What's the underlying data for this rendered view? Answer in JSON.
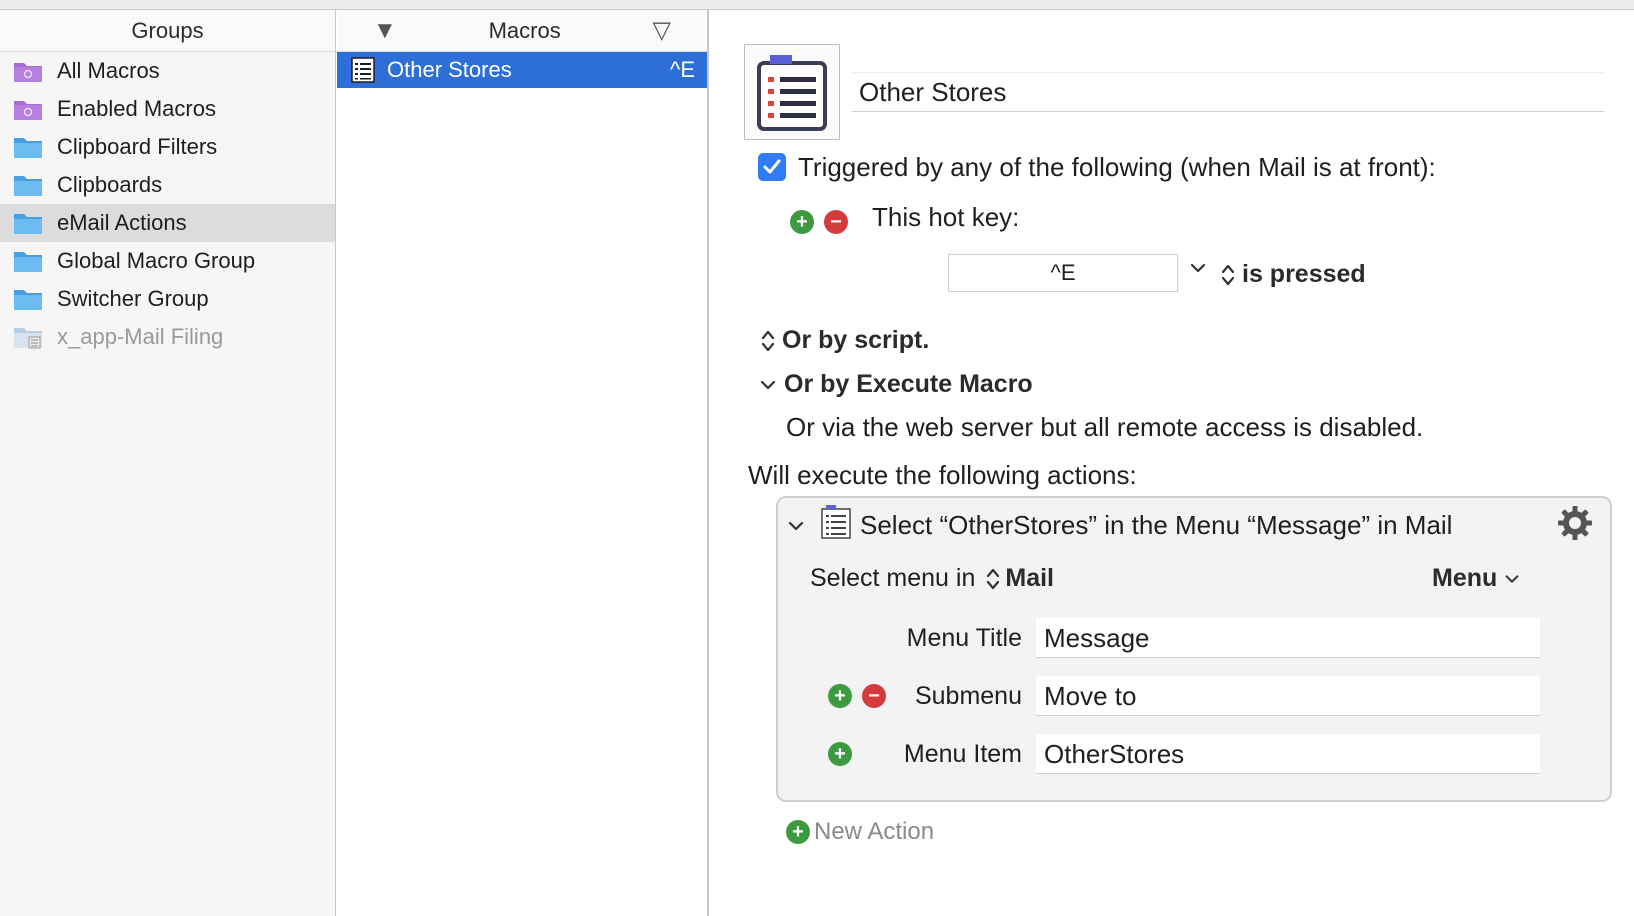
{
  "groups": {
    "header": "Groups",
    "items": [
      {
        "label": "All Macros",
        "icon": "smart-group-icon",
        "color": "#a86ad8"
      },
      {
        "label": "Enabled Macros",
        "icon": "smart-group-icon",
        "color": "#a86ad8"
      },
      {
        "label": "Clipboard Filters",
        "icon": "folder-icon",
        "color": "#5aaee9"
      },
      {
        "label": "Clipboards",
        "icon": "folder-icon",
        "color": "#5aaee9"
      },
      {
        "label": "eMail Actions",
        "icon": "folder-icon",
        "color": "#5aaee9"
      },
      {
        "label": "Global Macro Group",
        "icon": "folder-icon",
        "color": "#5aaee9"
      },
      {
        "label": "Switcher Group",
        "icon": "folder-icon",
        "color": "#5aaee9"
      },
      {
        "label": "x_app-Mail Filing",
        "icon": "disabled-folder-icon",
        "color": "#c9d9e8"
      }
    ],
    "selected": "eMail Actions"
  },
  "macros": {
    "header": "Macros",
    "items": [
      {
        "label": "Other Stores",
        "hotkey": "^E"
      }
    ]
  },
  "editor": {
    "macro_name": "Other Stores",
    "trigger_text": "Triggered by any of the following (when Mail is at front):",
    "hotkey_label": "This hot key:",
    "hotkey_value": "^E",
    "hotkey_state": "is pressed",
    "or_by_script": "Or by script.",
    "or_by_execute": "Or by Execute Macro",
    "web_server_text": "Or via the web server but all remote access is disabled.",
    "will_execute": "Will execute the following actions:",
    "action": {
      "title": "Select “OtherStores” in the Menu “Message” in Mail",
      "select_menu_in": "Select menu in",
      "app": "Mail",
      "menu_dropdown": "Menu",
      "menu_title_label": "Menu Title",
      "menu_title_value": "Message",
      "submenu_label": "Submenu",
      "submenu_value": "Move to",
      "menu_item_label": "Menu Item",
      "menu_item_value": "OtherStores"
    },
    "new_action": "New Action"
  },
  "colors": {
    "selection_blue": "#2e6fd7",
    "checkbox_blue": "#2f7cf6",
    "plus_green": "#3d9a41",
    "minus_red": "#d43b3b"
  }
}
